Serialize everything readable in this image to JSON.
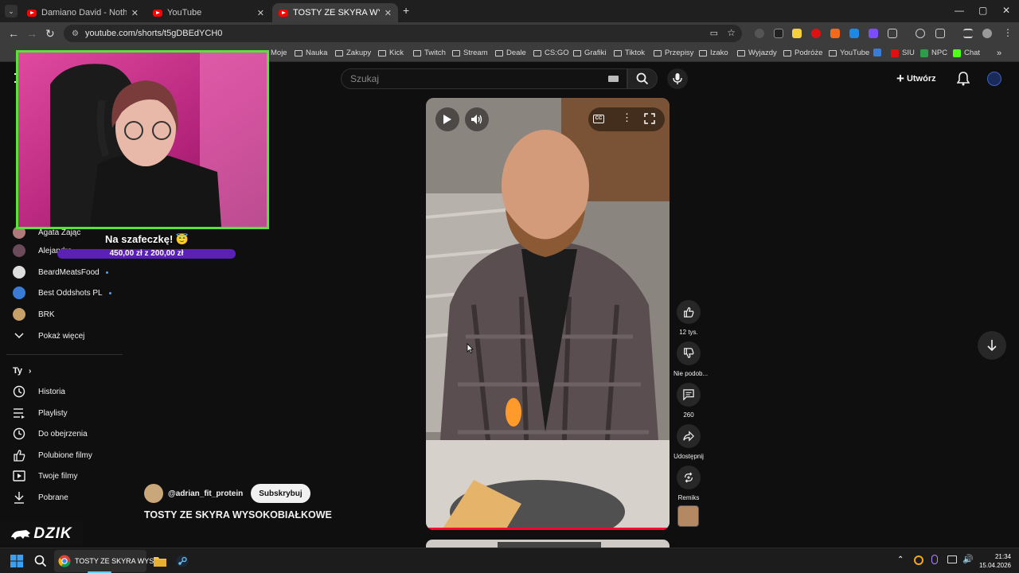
{
  "browser": {
    "tabs": [
      {
        "title": "Damiano David - Nothing Breaks",
        "active": false
      },
      {
        "title": "YouTube",
        "active": false
      },
      {
        "title": "TOSTY ZE SKYRA WYSOKOBIAŁKOWE",
        "active": true
      }
    ],
    "new_tab_icon": "plus-icon",
    "url": "youtube.com/shorts/t5gDBEdYCH0",
    "bookmarks": [
      "Moje",
      "Nauka",
      "Zakupy",
      "Kick",
      "Twitch",
      "Stream",
      "Deale",
      "CS:GO",
      "Grafiki",
      "Tiktok",
      "Przepisy",
      "Izako",
      "Wyjazdy",
      "Podróże",
      "YouTube",
      "SIU",
      "NPC",
      "Chat"
    ]
  },
  "youtube": {
    "search_placeholder": "Szukaj",
    "create_label": "Utwórz",
    "accent": "#ff0000"
  },
  "sidebar": {
    "subscriptions": [
      {
        "name": "Agata Zając",
        "color": "#b07a7a"
      },
      {
        "name": "Alejandro...",
        "color": "#6b4b5a"
      },
      {
        "name": "BeardMeatsFood",
        "color": "#dddddd"
      },
      {
        "name": "Best Oddshots PL",
        "color": "#3a7bd5"
      },
      {
        "name": "BRK",
        "color": "#c8a16a"
      }
    ],
    "show_more": "Pokaż więcej",
    "you_heading": "Ty",
    "you_items": [
      {
        "label": "Historia",
        "icon": "history-icon"
      },
      {
        "label": "Playlisty",
        "icon": "playlist-icon"
      },
      {
        "label": "Do obejrzenia",
        "icon": "clock-icon"
      },
      {
        "label": "Polubione filmy",
        "icon": "thumbs-up-icon"
      },
      {
        "label": "Twoje filmy",
        "icon": "your-videos-icon"
      },
      {
        "label": "Pobrane",
        "icon": "download-icon"
      }
    ]
  },
  "overlay": {
    "donation_text": "Na szafeczkę! 😇",
    "goal_text": "450,00 zł z 200,00 zł",
    "logo_text": "DZIK"
  },
  "short": {
    "channel": "@adrian_fit_protein",
    "subscribe_label": "Subskrybuj",
    "title": "TOSTY ZE SKYRA WYSOKOBIAŁKOWE",
    "actions": [
      {
        "label": "12 tys.",
        "icon": "thumbs-up-icon"
      },
      {
        "label": "Nie podob...",
        "icon": "thumbs-down-icon"
      },
      {
        "label": "260",
        "icon": "comment-icon"
      },
      {
        "label": "Udostępnij",
        "icon": "share-icon"
      },
      {
        "label": "Remiks",
        "icon": "remix-icon"
      }
    ]
  },
  "taskbar": {
    "chrome_label": "TOSTY ZE SKYRA WYSO",
    "time": "21:34",
    "date": "15.04.2026"
  }
}
